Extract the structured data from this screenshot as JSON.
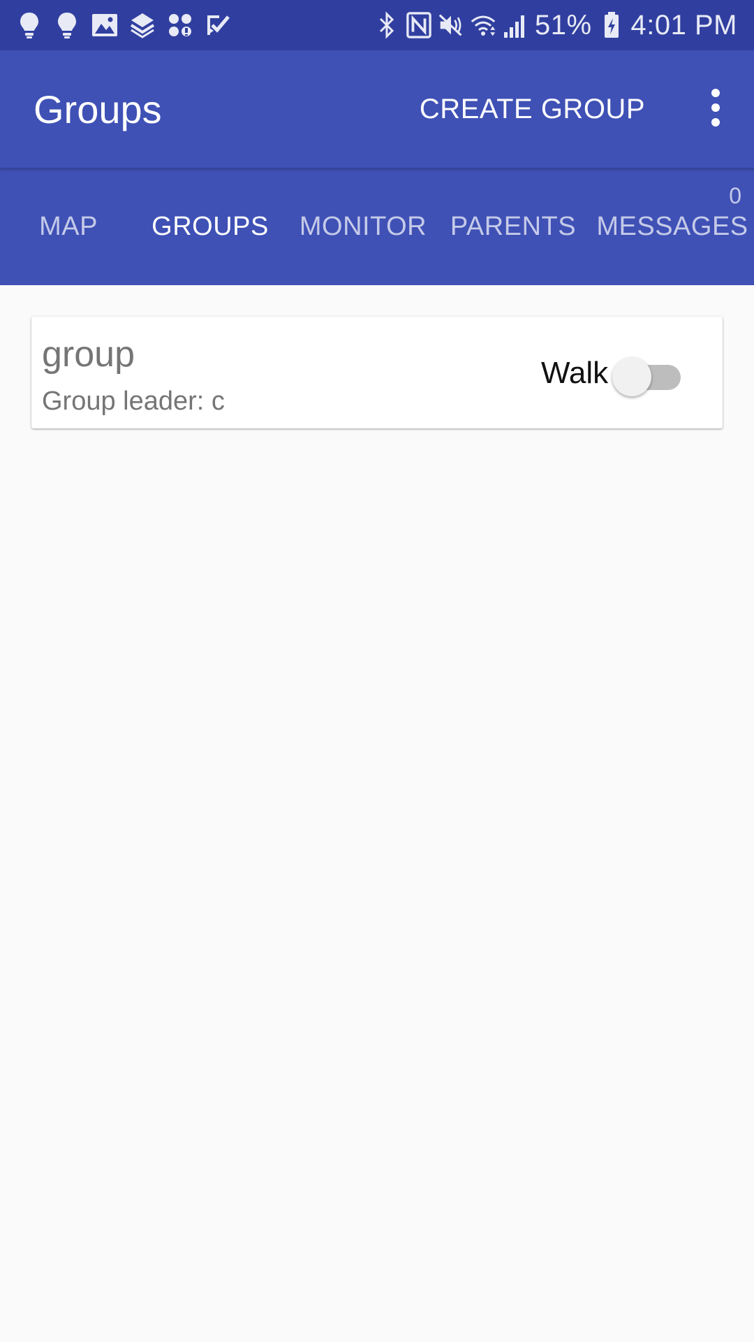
{
  "status_bar": {
    "left_icons": [
      "bulb-icon",
      "bulb-icon",
      "image-icon",
      "layers-icon",
      "apps-icon",
      "check-icon"
    ],
    "right_icons": [
      "bluetooth-icon",
      "nfc-icon",
      "mute-icon",
      "wifi-icon",
      "signal-icon"
    ],
    "battery": "51%",
    "battery_icon": "battery-charging-icon",
    "time": "4:01 PM"
  },
  "app_bar": {
    "title": "Groups",
    "action_label": "CREATE GROUP",
    "menu_icon": "more-vert-icon"
  },
  "tabs": [
    {
      "label": "MAP",
      "active": false
    },
    {
      "label": "GROUPS",
      "active": true
    },
    {
      "label": "MONITOR",
      "active": false
    },
    {
      "label": "PARENTS",
      "active": false
    },
    {
      "label": "MESSAGES",
      "active": false,
      "badge": "0"
    }
  ],
  "groups": [
    {
      "name": "group",
      "leader": "Group leader: c",
      "toggle_label": "Walk",
      "toggle_on": false
    }
  ],
  "colors": {
    "status_bar": "#303f9f",
    "primary": "#3f51b5",
    "background": "#fafafa",
    "tab_inactive": "#c5cae9",
    "switch_track_off": "#bdbdbd"
  }
}
